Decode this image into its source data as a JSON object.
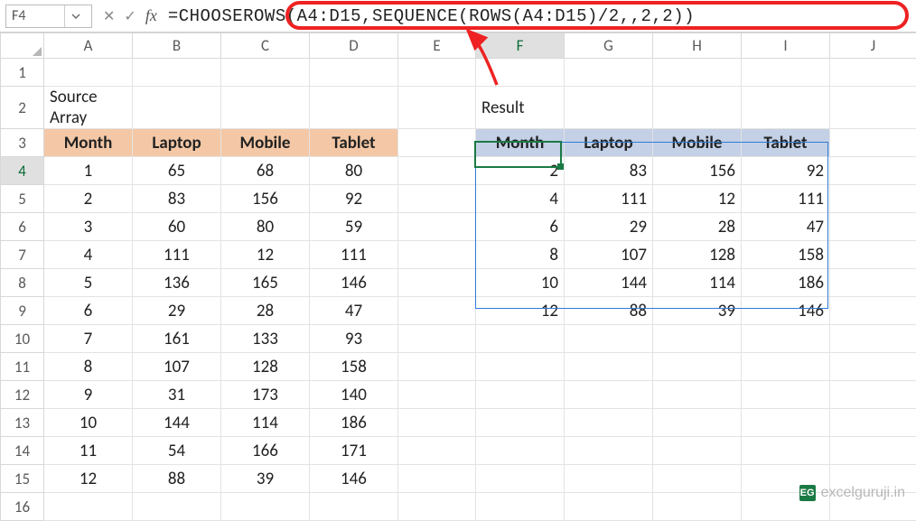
{
  "name_box": "F4",
  "fx_label": "fx",
  "formula": "=CHOOSEROWS(A4:D15,SEQUENCE(ROWS(A4:D15)/2,,2,2))",
  "columns": [
    "A",
    "B",
    "C",
    "D",
    "E",
    "F",
    "G",
    "H",
    "I",
    "J"
  ],
  "row_numbers": [
    1,
    2,
    3,
    4,
    5,
    6,
    7,
    8,
    9,
    10,
    11,
    12,
    13,
    14,
    15,
    16
  ],
  "labels": {
    "source": "Source Array",
    "result": "Result"
  },
  "source_headers": [
    "Month",
    "Laptop",
    "Mobile",
    "Tablet"
  ],
  "source_rows": [
    [
      1,
      65,
      68,
      80
    ],
    [
      2,
      83,
      156,
      92
    ],
    [
      3,
      60,
      80,
      59
    ],
    [
      4,
      111,
      12,
      111
    ],
    [
      5,
      136,
      165,
      146
    ],
    [
      6,
      29,
      28,
      47
    ],
    [
      7,
      161,
      133,
      93
    ],
    [
      8,
      107,
      128,
      158
    ],
    [
      9,
      31,
      173,
      140
    ],
    [
      10,
      144,
      114,
      186
    ],
    [
      11,
      54,
      166,
      171
    ],
    [
      12,
      88,
      39,
      146
    ]
  ],
  "result_headers": [
    "Month",
    "Laptop",
    "Mobile",
    "Tablet"
  ],
  "result_rows": [
    [
      2,
      83,
      156,
      92
    ],
    [
      4,
      111,
      12,
      111
    ],
    [
      6,
      29,
      28,
      47
    ],
    [
      8,
      107,
      128,
      158
    ],
    [
      10,
      144,
      114,
      186
    ],
    [
      12,
      88,
      39,
      146
    ]
  ],
  "watermark": "excelguruji.in",
  "watermark_logo": "EG",
  "chart_data": {
    "type": "table",
    "title": "CHOOSEROWS with SEQUENCE to pick every other row",
    "source": {
      "columns": [
        "Month",
        "Laptop",
        "Mobile",
        "Tablet"
      ],
      "rows": [
        [
          1,
          65,
          68,
          80
        ],
        [
          2,
          83,
          156,
          92
        ],
        [
          3,
          60,
          80,
          59
        ],
        [
          4,
          111,
          12,
          111
        ],
        [
          5,
          136,
          165,
          146
        ],
        [
          6,
          29,
          28,
          47
        ],
        [
          7,
          161,
          133,
          93
        ],
        [
          8,
          107,
          128,
          158
        ],
        [
          9,
          31,
          173,
          140
        ],
        [
          10,
          144,
          114,
          186
        ],
        [
          11,
          54,
          166,
          171
        ],
        [
          12,
          88,
          39,
          146
        ]
      ]
    },
    "result": {
      "columns": [
        "Month",
        "Laptop",
        "Mobile",
        "Tablet"
      ],
      "rows": [
        [
          2,
          83,
          156,
          92
        ],
        [
          4,
          111,
          12,
          111
        ],
        [
          6,
          29,
          28,
          47
        ],
        [
          8,
          107,
          128,
          158
        ],
        [
          10,
          144,
          114,
          186
        ],
        [
          12,
          88,
          39,
          146
        ]
      ]
    }
  }
}
